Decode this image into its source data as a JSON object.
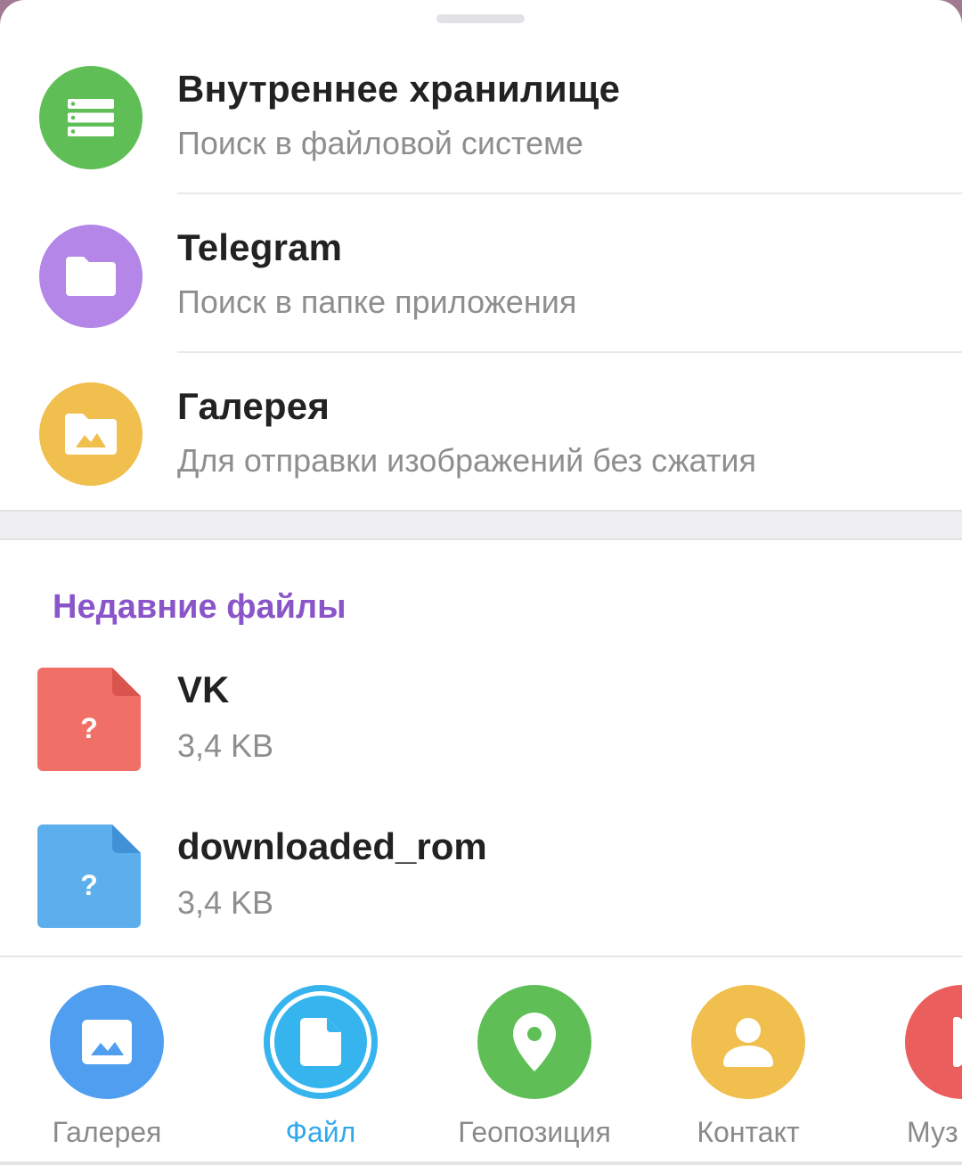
{
  "options": [
    {
      "title": "Внутреннее хранилище",
      "subtitle": "Поиск в файловой системе",
      "icon": "storage-icon",
      "color": "#5fbf56"
    },
    {
      "title": "Telegram",
      "subtitle": "Поиск в папке приложения",
      "icon": "folder-icon",
      "color": "#b386e8"
    },
    {
      "title": "Галерея",
      "subtitle": "Для отправки изображений без сжатия",
      "icon": "gallery-folder-icon",
      "color": "#f0bf4d"
    }
  ],
  "recent": {
    "title": "Недавние файлы",
    "files": [
      {
        "name": "VK",
        "size": "3,4 KB",
        "badge": "?",
        "color": "#f07068"
      },
      {
        "name": "downloaded_rom",
        "size": "3,4 KB",
        "badge": "?",
        "color": "#5caeec"
      }
    ]
  },
  "tabs": [
    {
      "label": "Галерея",
      "icon": "image-icon",
      "color": "#4f9ef0",
      "active": false
    },
    {
      "label": "Файл",
      "icon": "file-icon",
      "color": "#36b4ee",
      "active": true
    },
    {
      "label": "Геопозиция",
      "icon": "location-pin-icon",
      "color": "#5fbf56",
      "active": false
    },
    {
      "label": "Контакт",
      "icon": "contact-icon",
      "color": "#f0bf4d",
      "active": false
    },
    {
      "label": "Муз",
      "icon": "music-icon",
      "color": "#eb5e5e",
      "active": false
    }
  ]
}
